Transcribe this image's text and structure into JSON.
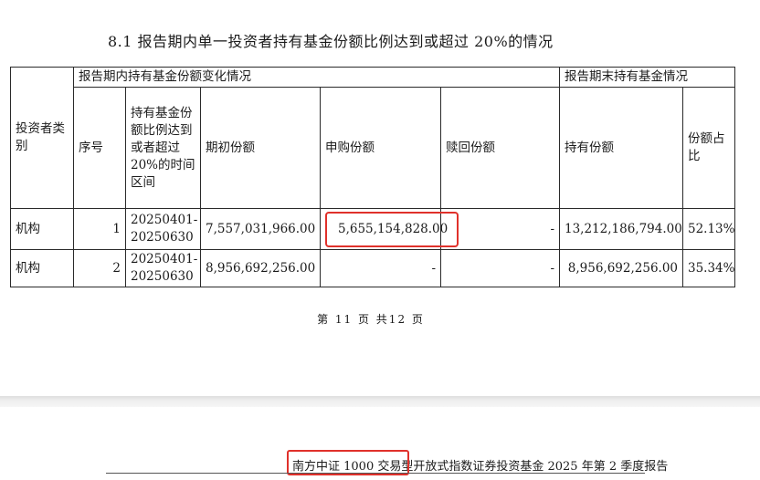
{
  "section": {
    "title": "8.1 报告期内单一投资者持有基金份额比例达到或超过 20%的情况"
  },
  "table": {
    "group_headers": {
      "investor_type": "投资者类别",
      "period_change": "报告期内持有基金份额变化情况",
      "period_end": "报告期末持有基金情况"
    },
    "columns": {
      "seq": "序号",
      "interval": "持有基金份额比例达到或者超过 20%的时间区间",
      "opening": "期初份额",
      "subscribe": "申购份额",
      "redeem": "赎回份额",
      "holding": "持有份额",
      "ratio": "份额占比"
    },
    "rows": [
      {
        "type": "机构",
        "seq": "1",
        "interval": "20250401-20250630",
        "opening": "7,557,031,966.00",
        "subscribe": "5,655,154,828.00",
        "redeem": "-",
        "holding": "13,212,186,794.00",
        "ratio": "52.13%"
      },
      {
        "type": "机构",
        "seq": "2",
        "interval": "20250401-20250630",
        "opening": "8,956,692,256.00",
        "subscribe": "-",
        "redeem": "-",
        "holding": "8,956,692,256.00",
        "ratio": "35.34%"
      }
    ]
  },
  "page_number": "第 11 页 共12 页",
  "footer": {
    "title": "南方中证 1000 交易型开放式指数证券投资基金 2025 年第 2 季度报告"
  },
  "colors": {
    "highlight_box": "#e0312b",
    "table_border": "#2a2a2a",
    "page_gap": "#e8e8e8"
  }
}
